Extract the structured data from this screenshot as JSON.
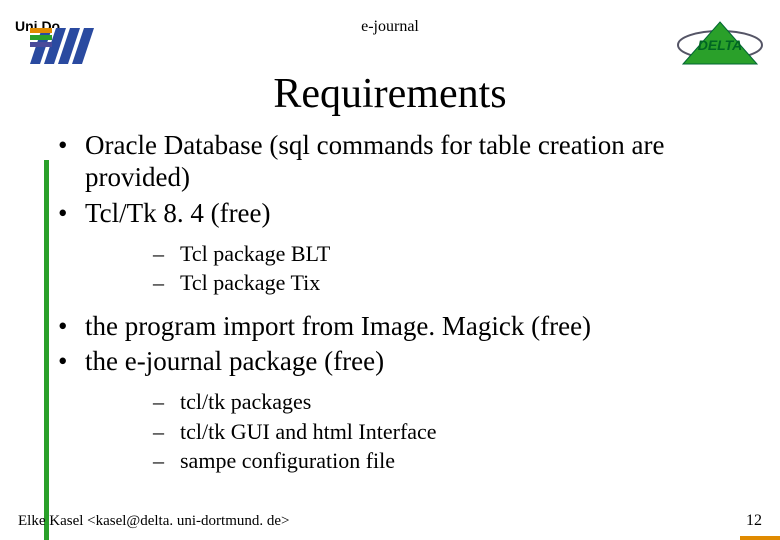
{
  "header": {
    "left_label": "Uni.Do",
    "center_label": "e-journal"
  },
  "title": "Requirements",
  "bullets": [
    {
      "text": "Oracle Database (sql commands for table creation are provided)"
    },
    {
      "text": "Tcl/Tk 8. 4 (free)",
      "sub": [
        "Tcl package BLT",
        "Tcl package Tix"
      ]
    },
    {
      "text": "the program import from Image. Magick (free)"
    },
    {
      "text": "the e-journal package (free)",
      "sub": [
        "tcl/tk packages",
        "tcl/tk GUI and html Interface",
        "sampe configuration file"
      ]
    }
  ],
  "footer": {
    "author_line": "Elke Kasel  <kasel@delta. uni-dortmund. de>",
    "page": "12"
  }
}
